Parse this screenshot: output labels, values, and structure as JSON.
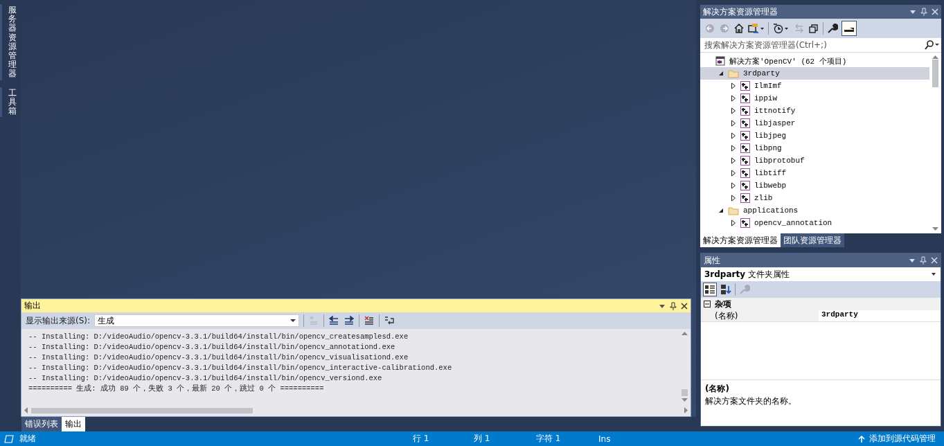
{
  "side_tabs": [
    {
      "label": "服务器资源管理器"
    },
    {
      "label": "工具箱"
    }
  ],
  "output_panel": {
    "title": "输出",
    "source_label": "显示输出来源(S):",
    "source_value": "生成",
    "lines": [
      "-- Installing: D:/videoAudio/opencv-3.3.1/build64/install/bin/opencv_createsamplesd.exe",
      "-- Installing: D:/videoAudio/opencv-3.3.1/build64/install/bin/opencv_annotationd.exe",
      "-- Installing: D:/videoAudio/opencv-3.3.1/build64/install/bin/opencv_visualisationd.exe",
      "-- Installing: D:/videoAudio/opencv-3.3.1/build64/install/bin/opencv_interactive-calibrationd.exe",
      "-- Installing: D:/videoAudio/opencv-3.3.1/build64/install/bin/opencv_versiond.exe",
      "========== 生成: 成功 89 个，失败 3 个，最新 20 个，跳过 0 个 =========="
    ]
  },
  "bottom_tabs": [
    {
      "label": "错误列表",
      "selected": false
    },
    {
      "label": "输出",
      "selected": true
    }
  ],
  "solution_explorer": {
    "title": "解决方案资源管理器",
    "search": {
      "placeholder": "搜索解决方案资源管理器(Ctrl+;)"
    },
    "tree": [
      {
        "label": "解决方案'OpenCV' (62 个项目)",
        "kind": "solution",
        "selected": false,
        "children": [
          {
            "label": "3rdparty",
            "kind": "folder",
            "expanded": true,
            "selected": true,
            "children": [
              {
                "label": "IlmImf",
                "kind": "project",
                "expanded": false,
                "selected": false
              },
              {
                "label": "ippiw",
                "kind": "project",
                "expanded": false,
                "selected": false
              },
              {
                "label": "ittnotify",
                "kind": "project",
                "expanded": false,
                "selected": false
              },
              {
                "label": "libjasper",
                "kind": "project",
                "expanded": false,
                "selected": false
              },
              {
                "label": "libjpeg",
                "kind": "project",
                "expanded": false,
                "selected": false
              },
              {
                "label": "libpng",
                "kind": "project",
                "expanded": false,
                "selected": false
              },
              {
                "label": "libprotobuf",
                "kind": "project",
                "expanded": false,
                "selected": false
              },
              {
                "label": "libtiff",
                "kind": "project",
                "expanded": false,
                "selected": false
              },
              {
                "label": "libwebp",
                "kind": "project",
                "expanded": false,
                "selected": false
              },
              {
                "label": "zlib",
                "kind": "project",
                "expanded": false,
                "selected": false
              }
            ]
          },
          {
            "label": "applications",
            "kind": "folder",
            "expanded": true,
            "selected": false,
            "children": [
              {
                "label": "opencv_annotation",
                "kind": "project",
                "expanded": false,
                "selected": false
              }
            ]
          }
        ]
      }
    ]
  },
  "explorer_tabs": [
    {
      "label": "解决方案资源管理器",
      "selected": true
    },
    {
      "label": "团队资源管理器",
      "selected": false
    }
  ],
  "properties": {
    "title": "属性",
    "object": "**3rdparty** 文件夹属性",
    "category": {
      "label": "杂项",
      "expanded": true
    },
    "rows": [
      {
        "name": "(名称)",
        "value": "3rdparty"
      }
    ],
    "description_title": "(名称)",
    "description": "解决方案文件夹的名称。"
  },
  "status_bar": {
    "message": "就绪",
    "line": "行 1",
    "column": "列 1",
    "char": "字符 1",
    "mode": "Ins",
    "source_control": "添加到源代码管理"
  }
}
